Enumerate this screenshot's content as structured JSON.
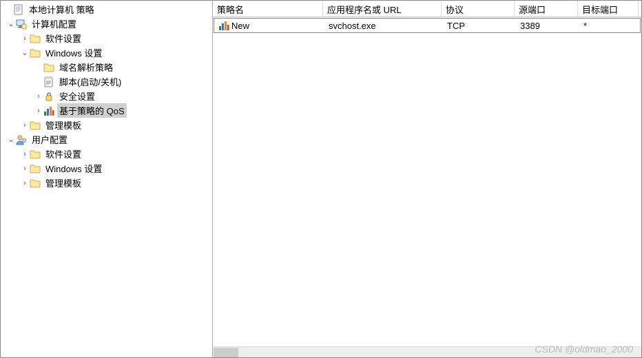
{
  "tree": {
    "root_label": "本地计算机 策略",
    "computer_config": "计算机配置",
    "software_settings": "软件设置",
    "windows_settings": "Windows 设置",
    "dns_policy": "域名解析策略",
    "scripts": "脚本(启动/关机)",
    "security_settings": "安全设置",
    "qos_policy": "基于策略的 QoS",
    "admin_templates": "管理模板",
    "user_config": "用户配置"
  },
  "columns": {
    "policy_name": "策略名",
    "app_or_url": "应用程序名或 URL",
    "protocol": "协议",
    "source_port": "源端口",
    "dest_port": "目标端口"
  },
  "rows": [
    {
      "policy_name": "New",
      "app_or_url": "svchost.exe",
      "protocol": "TCP",
      "source_port": "3389",
      "dest_port": "*"
    }
  ],
  "watermark": "CSDN @oldmao_2000"
}
